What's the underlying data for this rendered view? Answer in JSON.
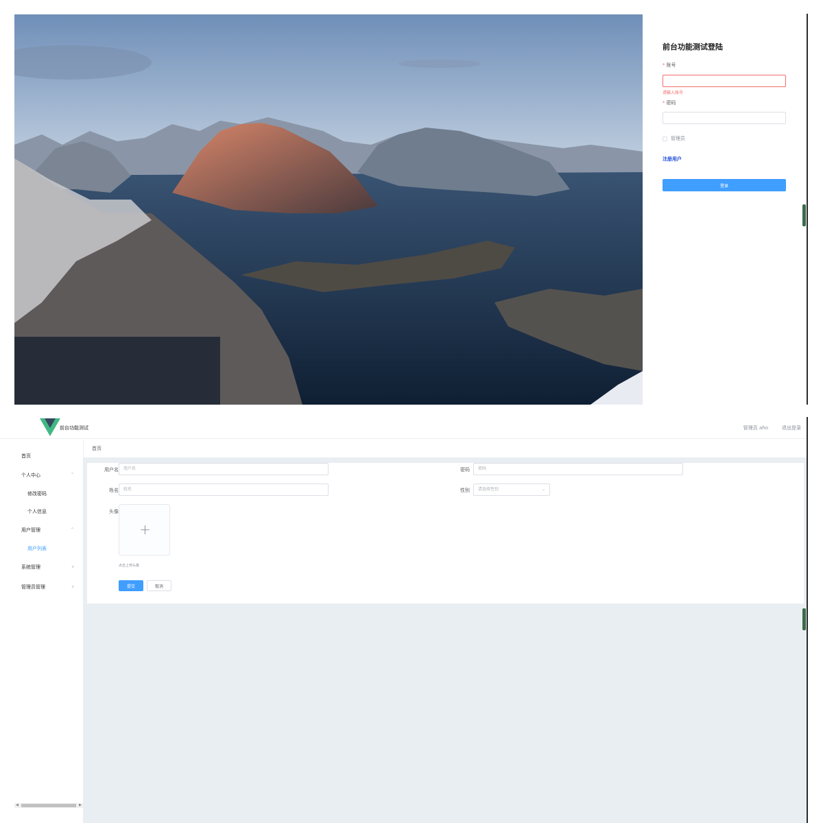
{
  "login": {
    "title": "前台功能测试登陆",
    "account_label": "账号",
    "account_error": "请输入账号",
    "password_label": "密码",
    "admin_checkbox_label": "管理员",
    "register_link": "注册用户",
    "login_button": "登录"
  },
  "admin": {
    "app_title": "前台功能测试",
    "header": {
      "user_label": "管理员 aho",
      "logout_label": "退出登录"
    },
    "sidebar": {
      "items": [
        {
          "label": "首页"
        },
        {
          "label": "个人中心",
          "chevron": "^"
        },
        {
          "label": "修改密码"
        },
        {
          "label": "个人信息"
        },
        {
          "label": "用户管理",
          "chevron": "^"
        },
        {
          "label": "用户列表"
        },
        {
          "label": "系统管理",
          "chevron": "v"
        },
        {
          "label": "管理员管理",
          "chevron": "v"
        }
      ]
    },
    "breadcrumb": "首页",
    "form": {
      "username_label": "用户名",
      "username_placeholder": "用户名",
      "password_label": "密码",
      "password_placeholder": "密码",
      "name_label": "姓名",
      "name_placeholder": "姓名",
      "gender_label": "性别",
      "gender_placeholder": "请选择性别",
      "avatar_label": "头像",
      "upload_plus": "+",
      "upload_tip": "点击上传头像",
      "submit_button": "提交",
      "cancel_button": "取消"
    }
  },
  "colors": {
    "primary": "#409eff",
    "error": "#f56c6c",
    "link": "#1e4bd8",
    "content_bg": "#e9eef3",
    "vue_green": "#41b883",
    "vue_dark": "#35495e"
  },
  "icons": {
    "logo": "vue-logo-icon",
    "upload": "plus-icon",
    "select": "chevron-down-icon"
  }
}
